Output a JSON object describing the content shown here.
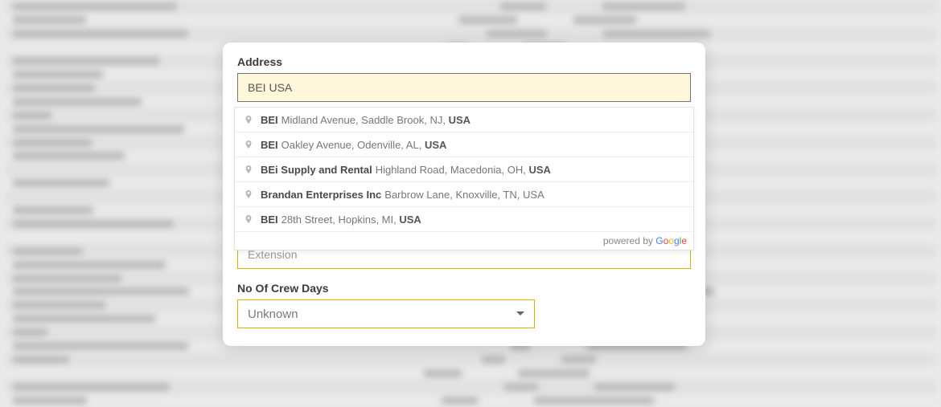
{
  "address": {
    "label": "Address",
    "value": "BEI USA"
  },
  "suggestions": [
    {
      "main": "BEI",
      "secondary_pre": "Midland Avenue, Saddle Brook, NJ, ",
      "secondary_bold": "USA"
    },
    {
      "main": "BEI",
      "secondary_pre": "Oakley Avenue, Odenville, AL, ",
      "secondary_bold": "USA"
    },
    {
      "main": "BEi Supply and Rental",
      "secondary_pre": "Highland Road, Macedonia, OH, ",
      "secondary_bold": "USA"
    },
    {
      "main": "Brandan Enterprises Inc",
      "secondary_pre": "Barbrow Lane, Knoxville, TN, USA",
      "secondary_bold": ""
    },
    {
      "main": "BEI",
      "secondary_pre": "28th Street, Hopkins, MI, ",
      "secondary_bold": "USA"
    }
  ],
  "powered_by_prefix": "powered by ",
  "extension": {
    "label": "Extension",
    "placeholder": "Extension",
    "value": ""
  },
  "crew_days": {
    "label": "No Of Crew Days",
    "selected": "Unknown"
  }
}
